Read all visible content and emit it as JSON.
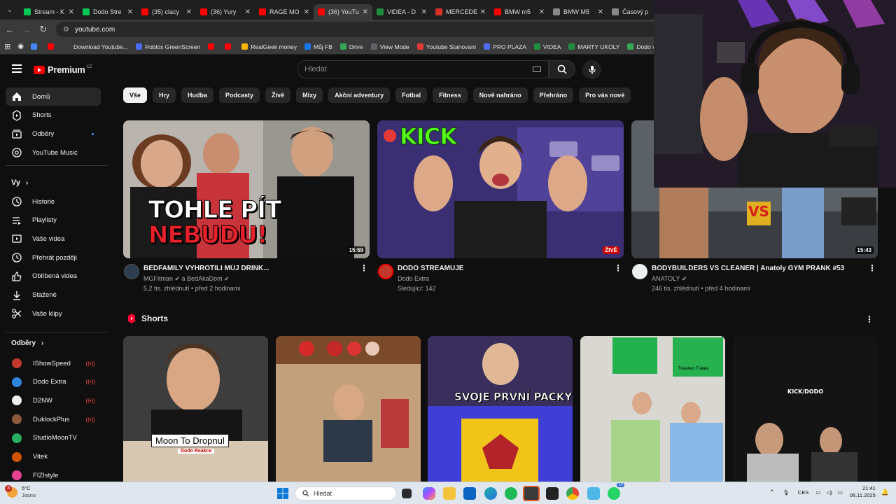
{
  "browser": {
    "tabs": [
      {
        "label": "Stream - K",
        "color": "#00c853",
        "active": false
      },
      {
        "label": "Dodo Stre",
        "color": "#00c853",
        "active": false
      },
      {
        "label": "(35) clacy",
        "color": "#ff0000",
        "active": false
      },
      {
        "label": "(36) Yury",
        "color": "#ff0000",
        "active": false
      },
      {
        "label": "RAGE MO",
        "color": "#ff0000",
        "active": false
      },
      {
        "label": "(36) YouTu",
        "color": "#ff0000",
        "active": true
      },
      {
        "label": "VIDEA - D",
        "color": "#1e8e3e",
        "active": false
      },
      {
        "label": "MERCEDE",
        "color": "#d93025",
        "active": false
      },
      {
        "label": "BMW m5",
        "color": "#ff0000",
        "active": false
      },
      {
        "label": "BMW M5",
        "color": "#888888",
        "active": false
      },
      {
        "label": "Časový p",
        "color": "#888888",
        "active": false
      }
    ],
    "url": "youtube.com",
    "bookmarks": [
      {
        "label": "",
        "color": "#4285f4"
      },
      {
        "label": "",
        "color": "#ff0000"
      },
      {
        "label": "Download Youtube...",
        "color": "#3a3a3a"
      },
      {
        "label": "Roblox GreenScreen",
        "color": "#4a6cf7"
      },
      {
        "label": "",
        "color": "#ff0000"
      },
      {
        "label": "",
        "color": "#ff0000"
      },
      {
        "label": "RealGeek money",
        "color": "#f4b400"
      },
      {
        "label": "Můj FB",
        "color": "#1877f2"
      },
      {
        "label": "Drive",
        "color": "#34a853"
      },
      {
        "label": "View Mode",
        "color": "#5f6368"
      },
      {
        "label": "Youtube Stahovaní",
        "color": "#e53935"
      },
      {
        "label": "PRO PLAZA",
        "color": "#4a6cf7"
      },
      {
        "label": "VIDEA",
        "color": "#1e8e3e"
      },
      {
        "label": "MARTY UKOLY",
        "color": "#1e8e3e"
      },
      {
        "label": "Dodo videa",
        "color": "#34a853"
      }
    ]
  },
  "header": {
    "brand": "Premium",
    "country": "CZ",
    "search_placeholder": "Hledat"
  },
  "sidebar": {
    "main": [
      {
        "label": "Domů",
        "icon": "home-icon",
        "active": true
      },
      {
        "label": "Shorts",
        "icon": "shorts-icon"
      },
      {
        "label": "Odběry",
        "icon": "subscriptions-icon",
        "dot": true
      },
      {
        "label": "YouTube Music",
        "icon": "music-icon"
      }
    ],
    "you_title": "Vy",
    "you": [
      {
        "label": "Historie",
        "icon": "history-icon"
      },
      {
        "label": "Playlisty",
        "icon": "playlists-icon"
      },
      {
        "label": "Vaše videa",
        "icon": "your-videos-icon"
      },
      {
        "label": "Přehrát později",
        "icon": "watch-later-icon"
      },
      {
        "label": "Oblíbená videa",
        "icon": "liked-icon"
      },
      {
        "label": "Stažené",
        "icon": "download-icon"
      },
      {
        "label": "Vaše klipy",
        "icon": "clips-icon"
      }
    ],
    "subs_title": "Odběry",
    "subs": [
      {
        "label": "IShowSpeed",
        "color": "#c0392b",
        "live": true
      },
      {
        "label": "Dodo Extra",
        "color": "#2e86de",
        "live": true
      },
      {
        "label": "D2NW",
        "color": "#ecf0f1",
        "live": true
      },
      {
        "label": "DuklockPlus",
        "color": "#8e5a3c",
        "live": true
      },
      {
        "label": "StudioMoonTV",
        "color": "#27ae60",
        "live": false
      },
      {
        "label": "Vitek",
        "color": "#d35400",
        "live": false
      },
      {
        "label": "FIZIstyle",
        "color": "#e84393",
        "live": false
      }
    ],
    "live_glyph": "((•))"
  },
  "chips": [
    "Vše",
    "Hry",
    "Hudba",
    "Podcasty",
    "Živě",
    "Mixy",
    "Akční adventury",
    "Fotbal",
    "Fitness",
    "Nově nahráno",
    "Přehráno",
    "Pro vás nové"
  ],
  "videos": [
    {
      "title": "BEDFAMILY VYHROTILI MŮJ DRINK...",
      "channel": "MGFitman ✔ a BedAkaDom ✔",
      "stats": "5,2 tis. zhlédnutí • před 2 hodinami",
      "duration": "15:59",
      "thumb_text_1": "TOHLE PÍT",
      "thumb_text_2": "NEBUDU!",
      "avatar_color": "#2c3e50"
    },
    {
      "title": "DODO STREAMUJE",
      "channel": "Dodo Extra",
      "stats": "Sledující: 142",
      "live": "ŽIVĚ",
      "thumb_text_1": "KICK",
      "avatar_color": "#c0392b"
    },
    {
      "title": "BODYBUILDERS VS CLEANER  | Anatoly GYM PRANK #53",
      "channel": "ANATOLY ✔",
      "stats": "246 tis. zhlédnutí • před 4 hodinami",
      "duration": "15:43",
      "thumb_text_1": "VS",
      "avatar_color": "#ecf0f1"
    }
  ],
  "shorts": {
    "title": "Shorts",
    "items": [
      {
        "caption": "Moon To Dropnul",
        "sub": "Dodo Reakce"
      },
      {
        "caption": ""
      },
      {
        "caption": "SVOJE PRVNÍ PACKY"
      },
      {
        "caption": "Tralalero Tralala"
      },
      {
        "caption": "KICK/DODO"
      }
    ]
  },
  "taskbar": {
    "weather_temp": "5°C",
    "weather_desc": "Jasno",
    "weather_badge": "3",
    "search_placeholder": "Hledat",
    "lang": "CES",
    "time": "21:41",
    "date": "06.11.2025",
    "chat_badge": "14"
  }
}
